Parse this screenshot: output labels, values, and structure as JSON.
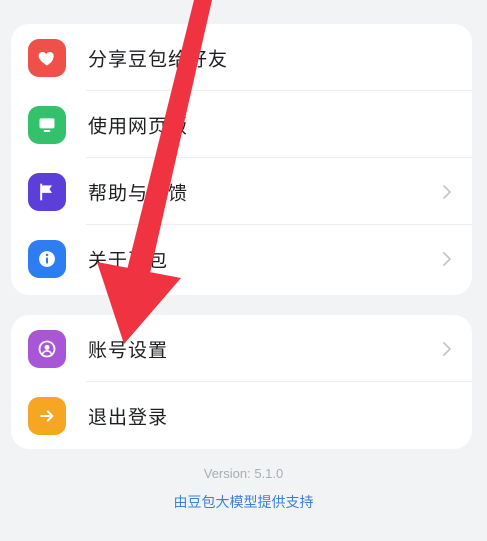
{
  "menu_group_1": {
    "items": [
      {
        "label": "分享豆包给好友",
        "icon": "heart-icon",
        "color": "#f0504a",
        "chevron": false
      },
      {
        "label": "使用网页版",
        "icon": "monitor-icon",
        "color": "#33c26b",
        "chevron": false
      },
      {
        "label": "帮助与反馈",
        "icon": "flag-icon",
        "color": "#5b3fd8",
        "chevron": true
      },
      {
        "label": "关于豆包",
        "icon": "info-icon",
        "color": "#2f7df2",
        "chevron": true
      }
    ]
  },
  "menu_group_2": {
    "items": [
      {
        "label": "账号设置",
        "icon": "user-circle-icon",
        "color": "#a855d6",
        "chevron": true
      },
      {
        "label": "退出登录",
        "icon": "arrow-right-icon",
        "color": "#f5a623",
        "chevron": false
      }
    ]
  },
  "footer": {
    "version": "Version: 5.1.0",
    "powered_by": "由豆包大模型提供支持"
  },
  "annotation": {
    "arrow_color": "#ef3340"
  }
}
